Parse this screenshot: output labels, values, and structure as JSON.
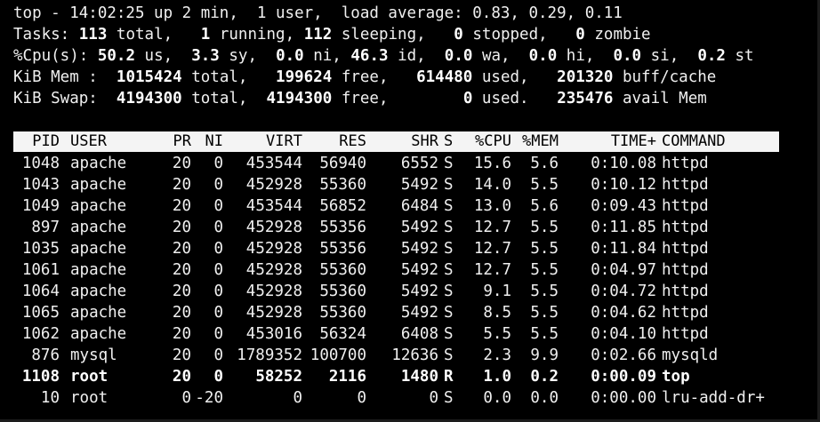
{
  "summary": {
    "line1": "top - 14:02:25 up 2 min,  1 user,  load average: 0.83, 0.29, 0.11",
    "tasks": {
      "label": "Tasks:",
      "total": "113",
      "total_label": "total,",
      "running": "1",
      "running_label": "running,",
      "sleeping": "112",
      "sleeping_label": "sleeping,",
      "stopped": "0",
      "stopped_label": "stopped,",
      "zombie": "0",
      "zombie_label": "zombie"
    },
    "cpu": {
      "label": "%Cpu(s):",
      "us": "50.2",
      "us_label": "us,",
      "sy": "3.3",
      "sy_label": "sy,",
      "ni": "0.0",
      "ni_label": "ni,",
      "id": "46.3",
      "id_label": "id,",
      "wa": "0.0",
      "wa_label": "wa,",
      "hi": "0.0",
      "hi_label": "hi,",
      "si": "0.0",
      "si_label": "si,",
      "st": "0.2",
      "st_label": "st"
    },
    "mem": {
      "label": "KiB Mem :",
      "total": "1015424",
      "total_label": "total,",
      "free": "199624",
      "free_label": "free,",
      "used": "614480",
      "used_label": "used,",
      "buff": "201320",
      "buff_label": "buff/cache"
    },
    "swap": {
      "label": "KiB Swap:",
      "total": "4194300",
      "total_label": "total,",
      "free": "4194300",
      "free_label": "free,",
      "used": "0",
      "used_label": "used.",
      "avail": "235476",
      "avail_label": "avail Mem"
    }
  },
  "columns": [
    "PID",
    "USER",
    "PR",
    "NI",
    "VIRT",
    "RES",
    "SHR",
    "S",
    "%CPU",
    "%MEM",
    "TIME+",
    "COMMAND"
  ],
  "processes": [
    [
      "1048",
      "apache",
      "20",
      "0",
      "453544",
      "56940",
      "6552",
      "S",
      "15.6",
      "5.6",
      "0:10.08",
      "httpd"
    ],
    [
      "1043",
      "apache",
      "20",
      "0",
      "452928",
      "55360",
      "5492",
      "S",
      "14.0",
      "5.5",
      "0:10.12",
      "httpd"
    ],
    [
      "1049",
      "apache",
      "20",
      "0",
      "453544",
      "56852",
      "6484",
      "S",
      "13.0",
      "5.6",
      "0:09.43",
      "httpd"
    ],
    [
      "897",
      "apache",
      "20",
      "0",
      "452928",
      "55356",
      "5492",
      "S",
      "12.7",
      "5.5",
      "0:11.85",
      "httpd"
    ],
    [
      "1035",
      "apache",
      "20",
      "0",
      "452928",
      "55356",
      "5492",
      "S",
      "12.7",
      "5.5",
      "0:11.84",
      "httpd"
    ],
    [
      "1061",
      "apache",
      "20",
      "0",
      "452928",
      "55360",
      "5492",
      "S",
      "12.7",
      "5.5",
      "0:04.97",
      "httpd"
    ],
    [
      "1064",
      "apache",
      "20",
      "0",
      "452928",
      "55360",
      "5492",
      "S",
      "9.1",
      "5.5",
      "0:04.72",
      "httpd"
    ],
    [
      "1065",
      "apache",
      "20",
      "0",
      "452928",
      "55360",
      "5492",
      "S",
      "8.5",
      "5.5",
      "0:04.62",
      "httpd"
    ],
    [
      "1062",
      "apache",
      "20",
      "0",
      "453016",
      "56324",
      "6408",
      "S",
      "5.5",
      "5.5",
      "0:04.10",
      "httpd"
    ],
    [
      "876",
      "mysql",
      "20",
      "0",
      "1789352",
      "100700",
      "12636",
      "S",
      "2.3",
      "9.9",
      "0:02.66",
      "mysqld"
    ],
    [
      "1108",
      "root",
      "20",
      "0",
      "58252",
      "2116",
      "1480",
      "R",
      "1.0",
      "0.2",
      "0:00.09",
      "top"
    ],
    [
      "10",
      "root",
      "0",
      "-20",
      "0",
      "0",
      "0",
      "S",
      "0.0",
      "0.0",
      "0:00.00",
      "lru-add-dr+"
    ]
  ],
  "highlight_pid": "1108"
}
